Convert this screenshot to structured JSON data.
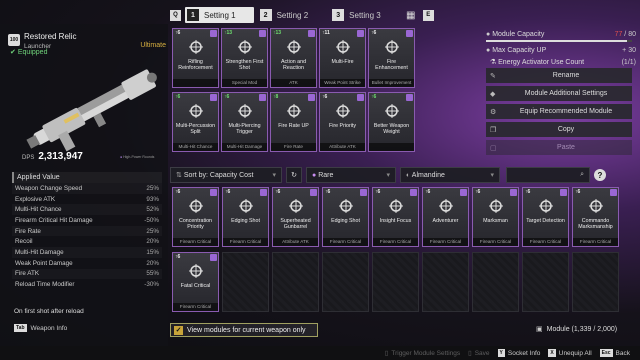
{
  "tabs": {
    "key_left": "Q",
    "key_right": "E",
    "items": [
      {
        "num": "1",
        "label": "Setting 1"
      },
      {
        "num": "2",
        "label": "Setting 2"
      },
      {
        "num": "3",
        "label": "Setting 3"
      }
    ],
    "active_index": 0
  },
  "weapon": {
    "level": "100",
    "name": "Restored Relic",
    "type": "Launcher",
    "rarity": "Ultimate",
    "rarity_color": "#d8b040",
    "equipped": "Equipped",
    "equipped_color": "#6fd27a",
    "dps_label": "DPS",
    "dps_value": "2,313,947",
    "rounds_label": "High-Power Rounds"
  },
  "stats": {
    "header": "Applied Value",
    "rows": [
      {
        "name": "Weapon Change Speed",
        "value": "25%"
      },
      {
        "name": "Explosive ATK",
        "value": "93%"
      },
      {
        "name": "Multi-Hit Chance",
        "value": "52%"
      },
      {
        "name": "Firearm Critical Hit Damage",
        "value": "-50%"
      },
      {
        "name": "Fire Rate",
        "value": "25%"
      },
      {
        "name": "Recoil",
        "value": "20%"
      },
      {
        "name": "Multi-Hit Damage",
        "value": "15%"
      },
      {
        "name": "Weak Point Damage",
        "value": "20%"
      },
      {
        "name": "Fire ATK",
        "value": "55%"
      },
      {
        "name": "Reload Time Modifier",
        "value": "-30%"
      }
    ],
    "footer_note": "On first shot after reload"
  },
  "weapon_info": {
    "key": "Tab",
    "label": "Weapon Info"
  },
  "equipped_modules": [
    {
      "cost": "↑6",
      "name": "Rifling Reinforcement",
      "footer": "",
      "green": false
    },
    {
      "cost": "↑13",
      "name": "Strengthen First Shot",
      "footer": "Special Mod",
      "green": true
    },
    {
      "cost": "↑13",
      "name": "Action and Reaction",
      "footer": "ATK",
      "green": true
    },
    {
      "cost": "↑11",
      "name": "Multi-Fire",
      "footer": "Weak Point Strike",
      "green": false
    },
    {
      "cost": "↑6",
      "name": "Fire Enhancement",
      "footer": "Bullet Improvement",
      "green": false
    },
    {
      "cost": "↑6",
      "name": "Multi-Percussion Split",
      "footer": "Multi-Hit Chance",
      "green": true
    },
    {
      "cost": "↑6",
      "name": "Multi-Piercing Trigger",
      "footer": "Multi-Hit Damage",
      "green": true
    },
    {
      "cost": "↑8",
      "name": "Fire Rate UP",
      "footer": "Fire Rate",
      "green": true
    },
    {
      "cost": "↑6",
      "name": "Fire Priority",
      "footer": "Attribute ATK",
      "green": false
    },
    {
      "cost": "↑6",
      "name": "Better Weapon Weight",
      "footer": "",
      "green": true
    }
  ],
  "capacity": {
    "module_capacity_label": "Module Capacity",
    "module_capacity_used": "77",
    "module_capacity_max": "80",
    "module_capacity_fraction": 0.9625,
    "max_capacity_up_label": "Max Capacity UP",
    "max_capacity_up_value": "+ 30",
    "activator_label": "Energy Activator Use Count",
    "activator_value": "(1/1)"
  },
  "actions": [
    {
      "icon": "✎",
      "label": "Rename",
      "dim": false
    },
    {
      "icon": "◆",
      "label": "Module Additional Settings",
      "dim": false
    },
    {
      "icon": "⚙",
      "label": "Equip Recommended Module",
      "dim": false
    },
    {
      "icon": "❐",
      "label": "Copy",
      "dim": false
    },
    {
      "icon": "▢",
      "label": "Paste",
      "dim": true
    }
  ],
  "filters": {
    "sort_label": "Sort by: Capacity Cost",
    "rarity_label": "Rare",
    "socket_label": "Almandine"
  },
  "inventory_modules": [
    {
      "cost": "↑6",
      "name": "Concentration Priority",
      "footer": "Firearm Critical"
    },
    {
      "cost": "↑6",
      "name": "Edging Shot",
      "footer": "Firearm Critical"
    },
    {
      "cost": "↑6",
      "name": "Superheated Gunbarrel",
      "footer": "Attribute ATK"
    },
    {
      "cost": "↑6",
      "name": "Edging Shot",
      "footer": "Firearm Critical"
    },
    {
      "cost": "↑6",
      "name": "Insight Focus",
      "footer": "Firearm Critical"
    },
    {
      "cost": "↑6",
      "name": "Adventurer",
      "footer": "Firearm Critical"
    },
    {
      "cost": "↑6",
      "name": "Marksman",
      "footer": "Firearm Critical"
    },
    {
      "cost": "↑6",
      "name": "Target Detection",
      "footer": "Firearm Critical"
    },
    {
      "cost": "↑6",
      "name": "Commando Marksmanship",
      "footer": "Firearm Critical"
    },
    {
      "cost": "↑6",
      "name": "Fatal Critical",
      "footer": "Firearm Critical"
    }
  ],
  "view_toggle": {
    "label": "View modules for current weapon only",
    "checked": true
  },
  "module_count": "Module (1,339 / 2,000)",
  "bottom_bar": [
    {
      "key": "",
      "label": "Trigger Module Settings",
      "dim": true
    },
    {
      "key": "",
      "label": "Save",
      "dim": true
    },
    {
      "key": "Y",
      "label": "Socket Info",
      "dim": false
    },
    {
      "key": "X",
      "label": "Unequip All",
      "dim": false
    },
    {
      "key": "Esc",
      "label": "Back",
      "dim": false
    }
  ]
}
